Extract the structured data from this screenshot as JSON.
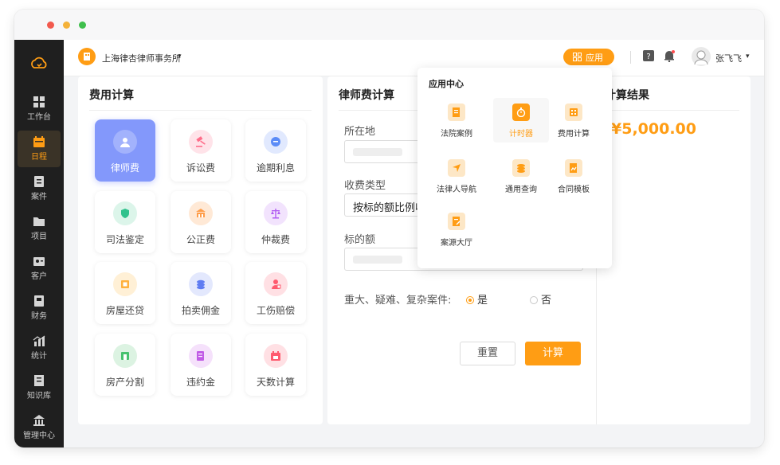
{
  "topbar": {
    "firm_name": "上海律杏律师事务所",
    "firm_caret": "▾",
    "app_button": "应用",
    "user_name": "张飞飞",
    "user_caret": "▾"
  },
  "sidebar": {
    "items": [
      {
        "label": "工作台",
        "icon": "dashboard-icon"
      },
      {
        "label": "日程",
        "icon": "calendar-icon",
        "active": true
      },
      {
        "label": "案件",
        "icon": "case-icon"
      },
      {
        "label": "项目",
        "icon": "folder-icon"
      },
      {
        "label": "客户",
        "icon": "client-icon"
      },
      {
        "label": "财务",
        "icon": "finance-icon"
      },
      {
        "label": "统计",
        "icon": "stats-icon"
      },
      {
        "label": "知识库",
        "icon": "knowledge-icon"
      },
      {
        "label": "管理中心",
        "icon": "admin-icon"
      }
    ]
  },
  "fee_panel": {
    "title": "费用计算",
    "tiles": [
      {
        "label": "律师费",
        "icon": "user-icon",
        "color": "#8398fb"
      },
      {
        "label": "诉讼费",
        "icon": "gavel-icon",
        "color": "#ff6d8a"
      },
      {
        "label": "逾期利息",
        "icon": "coin-icon",
        "color": "#5b8cf7"
      },
      {
        "label": "司法鉴定",
        "icon": "shield-icon",
        "color": "#2fc28c"
      },
      {
        "label": "公正费",
        "icon": "building-icon",
        "color": "#ff9d4a"
      },
      {
        "label": "仲裁费",
        "icon": "scale-icon",
        "color": "#b25df2"
      },
      {
        "label": "房屋还贷",
        "icon": "house-icon",
        "color": "#ffb13d"
      },
      {
        "label": "拍卖佣金",
        "icon": "coins-icon",
        "color": "#5f7cf2"
      },
      {
        "label": "工伤赔偿",
        "icon": "injury-icon",
        "color": "#ff5a6e"
      },
      {
        "label": "房产分割",
        "icon": "property-icon",
        "color": "#47c26f"
      },
      {
        "label": "违约金",
        "icon": "contract-icon",
        "color": "#c15ce6"
      },
      {
        "label": "天数计算",
        "icon": "calendar-icon",
        "color": "#ff5a6e"
      }
    ]
  },
  "lawyer_panel": {
    "title": "律师费计算",
    "location_label": "所在地",
    "fee_type_label": "收费类型",
    "fee_type_value": "按标的额比例收费",
    "amount_label": "标的额",
    "question_label": "重大、疑难、复杂案件:",
    "radio_yes": "是",
    "radio_no": "否",
    "reset_button": "重置",
    "calc_button": "计算"
  },
  "result_panel": {
    "title": "计算结果",
    "value": "¥5,000.00"
  },
  "app_center": {
    "title": "应用中心",
    "items": [
      {
        "label": "法院案例",
        "icon": "court-case-icon"
      },
      {
        "label": "计时器",
        "icon": "timer-icon",
        "active": true
      },
      {
        "label": "费用计算",
        "icon": "calculator-icon"
      },
      {
        "label": "法律人导航",
        "icon": "navigation-icon"
      },
      {
        "label": "通用查询",
        "icon": "query-icon"
      },
      {
        "label": "合同模板",
        "icon": "contract-template-icon"
      },
      {
        "label": "案源大厅",
        "icon": "case-source-icon"
      }
    ]
  },
  "colors": {
    "accent": "#ff9d14",
    "sidebar_bg": "#1f1f1f",
    "active_tile": "#8398fb"
  }
}
